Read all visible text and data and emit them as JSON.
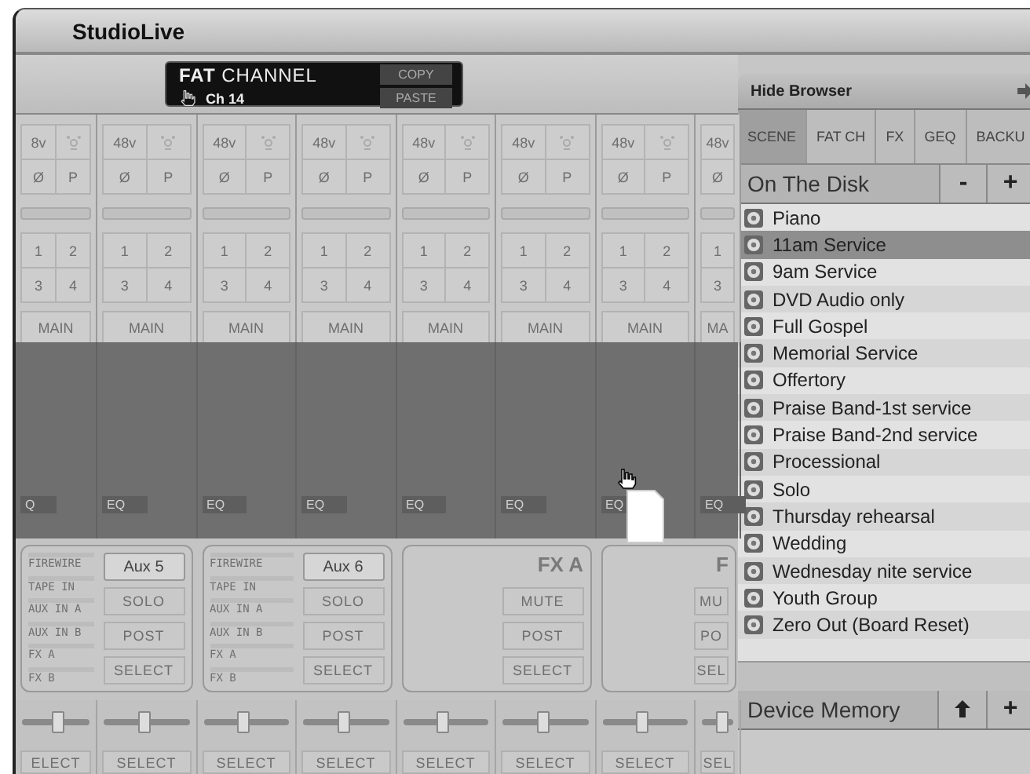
{
  "window": {
    "title": "StudioLive"
  },
  "fat_channel": {
    "title_bold": "FAT",
    "title": "CHANNEL",
    "channel": "Ch 14",
    "buttons": [
      "COPY",
      "PASTE"
    ]
  },
  "strips": [
    {
      "phantom": "8v",
      "polarity": "Ø",
      "p": "P",
      "bus_rows": [
        [
          "1",
          "2"
        ],
        [
          "3",
          "4"
        ]
      ],
      "main": "MAIN",
      "eq": "Q"
    },
    {
      "phantom": "48v",
      "polarity": "Ø",
      "p": "P",
      "bus_rows": [
        [
          "1",
          "2"
        ],
        [
          "3",
          "4"
        ]
      ],
      "main": "MAIN",
      "eq": "EQ"
    },
    {
      "phantom": "48v",
      "polarity": "Ø",
      "p": "P",
      "bus_rows": [
        [
          "1",
          "2"
        ],
        [
          "3",
          "4"
        ]
      ],
      "main": "MAIN",
      "eq": "EQ"
    },
    {
      "phantom": "48v",
      "polarity": "Ø",
      "p": "P",
      "bus_rows": [
        [
          "1",
          "2"
        ],
        [
          "3",
          "4"
        ]
      ],
      "main": "MAIN",
      "eq": "EQ"
    },
    {
      "phantom": "48v",
      "polarity": "Ø",
      "p": "P",
      "bus_rows": [
        [
          "1",
          "2"
        ],
        [
          "3",
          "4"
        ]
      ],
      "main": "MAIN",
      "eq": "EQ"
    },
    {
      "phantom": "48v",
      "polarity": "Ø",
      "p": "P",
      "bus_rows": [
        [
          "1",
          "2"
        ],
        [
          "3",
          "4"
        ]
      ],
      "main": "MAIN",
      "eq": "EQ"
    },
    {
      "phantom": "48v",
      "polarity": "Ø",
      "p": "P",
      "bus_rows": [
        [
          "1",
          "2"
        ],
        [
          "3",
          "4"
        ]
      ],
      "main": "MAIN",
      "eq": "EQ"
    },
    {
      "phantom": "48v",
      "polarity": "Ø",
      "bus_rows": [
        [
          "1"
        ],
        [
          "3"
        ]
      ],
      "main": "MA",
      "eq": "EQ"
    }
  ],
  "aux_groups": [
    {
      "kind": "aux",
      "label": "Aux 5",
      "sources": [
        "FIREWIRE",
        "TAPE IN",
        "AUX IN A",
        "AUX IN B",
        "FX A",
        "FX B"
      ],
      "buttons": [
        "SOLO",
        "POST",
        "SELECT"
      ]
    },
    {
      "kind": "aux",
      "label": "Aux 6",
      "sources": [
        "FIREWIRE",
        "TAPE IN",
        "AUX IN A",
        "AUX IN B",
        "FX A",
        "FX B"
      ],
      "buttons": [
        "SOLO",
        "POST",
        "SELECT"
      ]
    },
    {
      "kind": "fx",
      "label": "FX A",
      "buttons": [
        "MUTE",
        "POST",
        "SELECT"
      ]
    },
    {
      "kind": "fx",
      "label": "F",
      "buttons": [
        "MU",
        "PO",
        "SEL"
      ]
    }
  ],
  "faders": [
    {
      "level": 0.5
    },
    {
      "level": 0.45
    },
    {
      "level": 0.45
    },
    {
      "level": 0.45
    },
    {
      "level": 0.45
    },
    {
      "level": 0.45
    },
    {
      "level": 0.45
    },
    {
      "level": 0.6
    }
  ],
  "select_buttons": [
    "ELECT",
    "SELECT",
    "SELECT",
    "SELECT",
    "SELECT",
    "SELECT",
    "SELECT",
    "SEL"
  ],
  "browser": {
    "hide_label": "Hide Browser",
    "tabs": [
      {
        "label": "SCENE",
        "selected": true
      },
      {
        "label": "FAT CH",
        "selected": false
      },
      {
        "label": "FX",
        "selected": false
      },
      {
        "label": "GEQ",
        "selected": false
      },
      {
        "label": "BACKU",
        "selected": false
      }
    ],
    "disk": {
      "title": "On The Disk",
      "buttons": [
        "-",
        "+"
      ],
      "items": [
        {
          "label": "Piano",
          "selected": false
        },
        {
          "label": "11am Service",
          "selected": true
        },
        {
          "label": "9am Service",
          "selected": false
        },
        {
          "label": "DVD Audio only",
          "selected": false
        },
        {
          "label": "Full Gospel",
          "selected": false
        },
        {
          "label": "Memorial Service",
          "selected": false
        },
        {
          "label": "Offertory",
          "selected": false
        },
        {
          "label": "Praise Band-1st service",
          "selected": false
        },
        {
          "label": "Praise Band-2nd service",
          "selected": false
        },
        {
          "label": "Processional",
          "selected": false
        },
        {
          "label": "Solo",
          "selected": false
        },
        {
          "label": "Thursday rehearsal",
          "selected": false
        },
        {
          "label": "Wedding",
          "selected": false
        },
        {
          "label": "Wednesday nite service",
          "selected": false
        },
        {
          "label": "Youth Group",
          "selected": false
        },
        {
          "label": "Zero Out (Board Reset)",
          "selected": false
        }
      ]
    },
    "device_memory": {
      "title": "Device Memory",
      "buttons": [
        "+"
      ]
    }
  }
}
